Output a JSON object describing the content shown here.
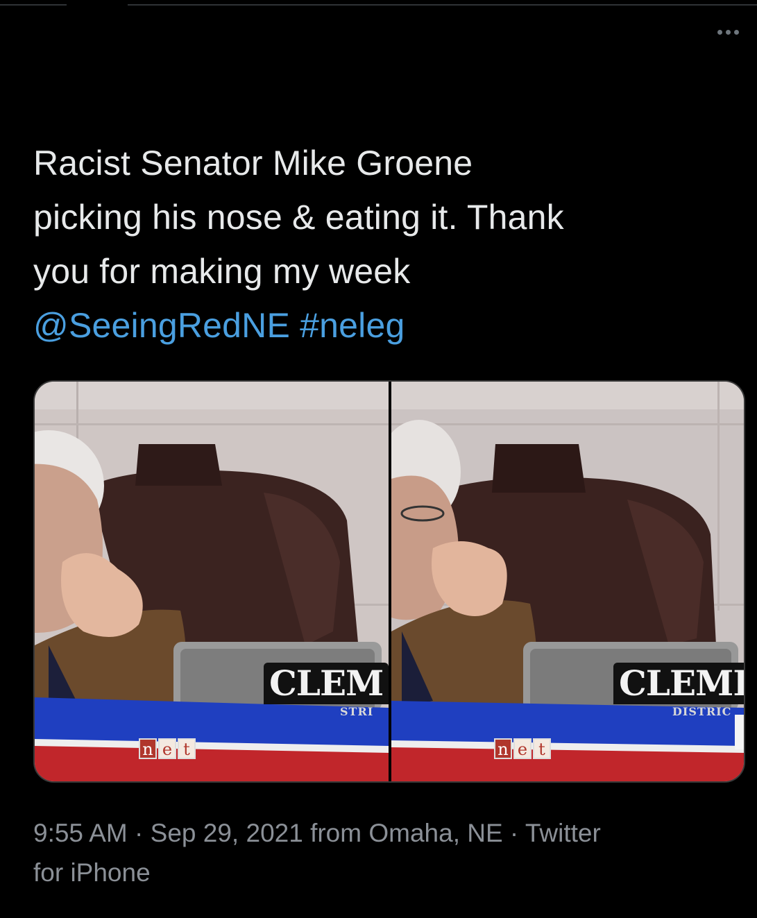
{
  "tweet": {
    "text_lines": [
      "Racist Senator Mike Groene",
      "picking his nose & eating it. Thank",
      "you for making my week"
    ],
    "mention": "@SeeingRedNE",
    "hashtag": "#neleg"
  },
  "media": {
    "left": {
      "nameplate": "CLEM",
      "nameplate_sub": "STRI",
      "logo_letters": [
        "n",
        "e",
        "t"
      ]
    },
    "right": {
      "nameplate": "CLEME",
      "nameplate_sub": "DISTRIC",
      "logo_letters": [
        "n",
        "e",
        "t"
      ]
    }
  },
  "meta": {
    "time": "9:55 AM",
    "sep1": " · ",
    "date": "Sep 29, 2021",
    "location": " from Omaha, NE",
    "sep2": " · ",
    "source_line1": "Twitter",
    "source_line2": "for iPhone"
  },
  "colors": {
    "background": "#000000",
    "text": "#e7e9ea",
    "link": "#4a9fe0",
    "meta": "#8b9097"
  },
  "icons": {
    "more": "more-horizontal-icon"
  }
}
